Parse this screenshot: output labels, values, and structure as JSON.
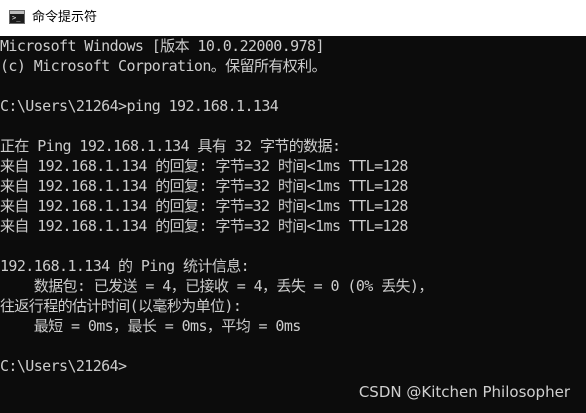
{
  "window": {
    "title": "命令提示符",
    "icon": "cmd-terminal-icon",
    "icon_glyph": ">_"
  },
  "console": {
    "lines": [
      "Microsoft Windows [版本 10.0.22000.978]",
      "(c) Microsoft Corporation。保留所有权利。",
      "",
      "C:\\Users\\21264>ping 192.168.1.134",
      "",
      "正在 Ping 192.168.1.134 具有 32 字节的数据:",
      "来自 192.168.1.134 的回复: 字节=32 时间<1ms TTL=128",
      "来自 192.168.1.134 的回复: 字节=32 时间<1ms TTL=128",
      "来自 192.168.1.134 的回复: 字节=32 时间<1ms TTL=128",
      "来自 192.168.1.134 的回复: 字节=32 时间<1ms TTL=128",
      "",
      "192.168.1.134 的 Ping 统计信息:",
      "    数据包: 已发送 = 4，已接收 = 4，丢失 = 0 (0% 丢失)，",
      "往返行程的估计时间(以毫秒为单位):",
      "    最短 = 0ms，最长 = 0ms，平均 = 0ms",
      "",
      "C:\\Users\\21264>"
    ]
  },
  "watermark": "CSDN @Kitchen Philosopher",
  "colors": {
    "console_background": "#0c0c0c",
    "console_text": "#cccccc",
    "titlebar_background": "#ffffff"
  }
}
